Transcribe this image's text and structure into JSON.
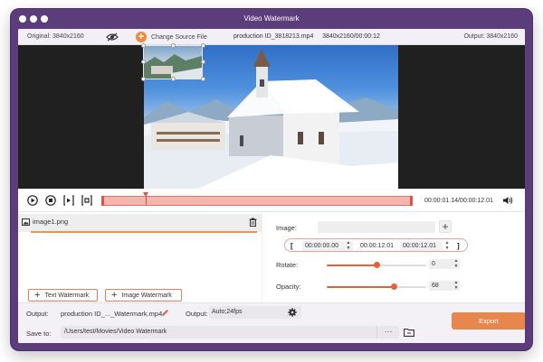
{
  "window": {
    "title": "Video Watermark",
    "traffic_lights": [
      "close-icon",
      "minimize-icon",
      "zoom-icon"
    ]
  },
  "info_bar": {
    "original": "Original: 3840x2160",
    "change_source": "Change Source File",
    "file_info": "production ID_3818213.mp4     3840x2160/00:00:12",
    "output": "Output: 3840x2160"
  },
  "player": {
    "time_readout": "00:00:01.14/00:00:12.01",
    "progress_fraction": 0.14
  },
  "watermark_list": {
    "items": [
      {
        "name": "image1.png"
      }
    ],
    "text_watermark_label": "Text Watermark",
    "image_watermark_label": "Image Watermark"
  },
  "settings": {
    "image_label": "Image:",
    "range": {
      "start": "00:00:00.00",
      "duration": "00:00:12.01",
      "end": "00:00:12.01"
    },
    "rotate_label": "Rotate:",
    "rotate_value": "0",
    "rotate_slider_fraction": 0.5,
    "opacity_label": "Opacity:",
    "opacity_value": "68",
    "opacity_slider_fraction": 0.68
  },
  "bottom": {
    "output_label": "Output:",
    "output_name": "production ID_..._Watermark.mp4",
    "format_label": "Output:",
    "format_value": "Auto;24fps",
    "save_label": "Save to:",
    "save_path": "/Users/test/Movies/Video Watermark",
    "browse_label": "···",
    "export_label": "Export"
  },
  "colors": {
    "window_frame": "#5a3d7a",
    "accent": "#e8874b",
    "timeline": "#f4b6ad",
    "slider": "#e8603a"
  }
}
